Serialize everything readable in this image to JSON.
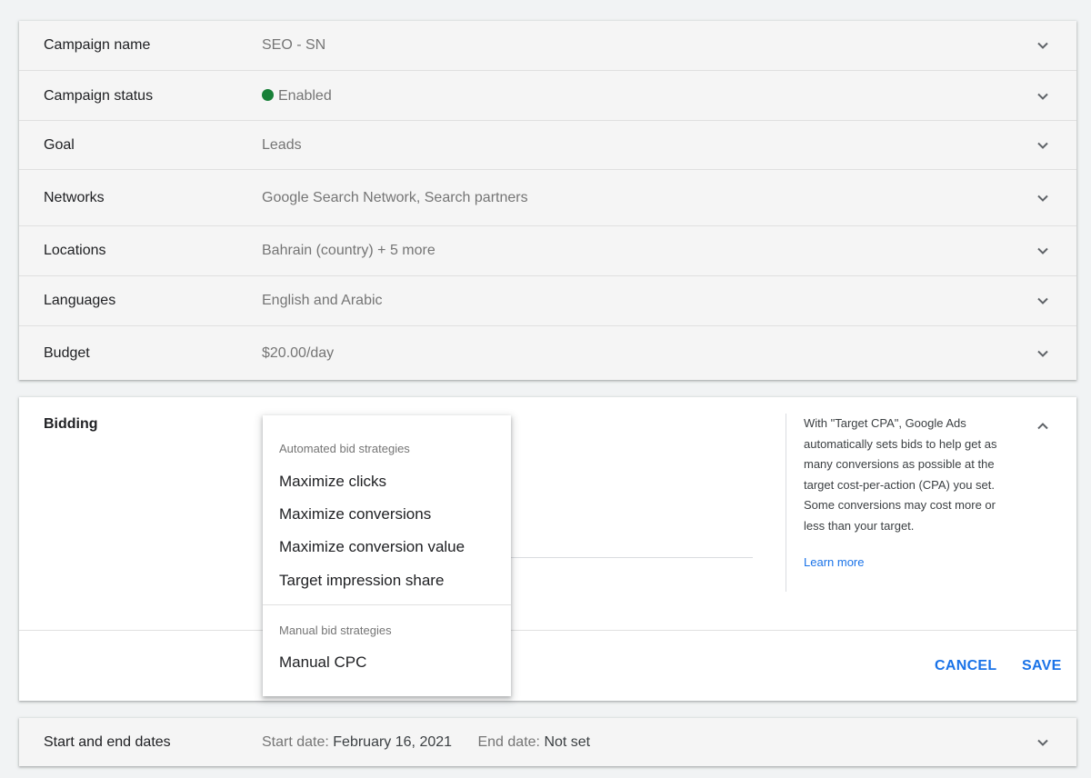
{
  "summary": {
    "rows": [
      {
        "label": "Campaign name",
        "value": "SEO - SN"
      },
      {
        "label": "Campaign status",
        "value": "Enabled",
        "status_color": "#188038"
      },
      {
        "label": "Goal",
        "value": "Leads"
      },
      {
        "label": "Networks",
        "value": "Google Search Network, Search partners"
      },
      {
        "label": "Locations",
        "value": "Bahrain (country) + 5 more"
      },
      {
        "label": "Languages",
        "value": "English and Arabic"
      },
      {
        "label": "Budget",
        "value": "$20.00/day"
      }
    ]
  },
  "bidding": {
    "title": "Bidding",
    "info_text": "With \"Target CPA\", Google Ads automatically sets bids to help get as many conversions as possible at the target cost-per-action (CPA) you set. Some conversions may cost more or less than your target.",
    "learn_more": "Learn more",
    "cancel_label": "CANCEL",
    "save_label": "SAVE"
  },
  "dropdown": {
    "automated_group": "Automated bid strategies",
    "automated_items": [
      "Maximize clicks",
      "Maximize conversions",
      "Maximize conversion value",
      "Target impression share"
    ],
    "manual_group": "Manual bid strategies",
    "manual_items": [
      "Manual CPC"
    ]
  },
  "dates": {
    "label": "Start and end dates",
    "start_label": "Start date:",
    "start_value": "February 16, 2021",
    "end_label": "End date:",
    "end_value": "Not set"
  },
  "colors": {
    "accent": "#1a73e8",
    "status_enabled": "#188038"
  },
  "icons": {
    "expand": "chevron-down-icon",
    "collapse": "chevron-up-icon"
  }
}
